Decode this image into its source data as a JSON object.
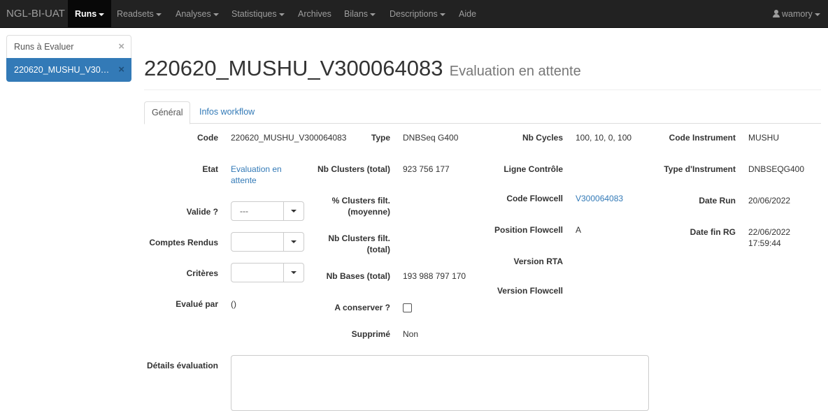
{
  "navbar": {
    "brand": "NGL-BI-UAT",
    "items": [
      {
        "label": "Runs",
        "dropdown": true
      },
      {
        "label": "Readsets",
        "dropdown": true
      },
      {
        "label": "Analyses",
        "dropdown": true
      },
      {
        "label": "Statistiques",
        "dropdown": true
      },
      {
        "label": "Archives",
        "dropdown": false
      },
      {
        "label": "Bilans",
        "dropdown": true
      },
      {
        "label": "Descriptions",
        "dropdown": true
      },
      {
        "label": "Aide",
        "dropdown": false
      }
    ],
    "user": "wamory"
  },
  "sidebar": {
    "items": [
      {
        "label": "Runs à Evaluer",
        "close": "×"
      },
      {
        "label": "220620_MUSHU_V300064083",
        "close": "×"
      }
    ]
  },
  "header": {
    "title": "220620_MUSHU_V300064083",
    "subtitle": "Evaluation en attente"
  },
  "tabs": [
    {
      "label": "Général"
    },
    {
      "label": "Infos workflow"
    }
  ],
  "col1": {
    "code_label": "Code",
    "code_value": "220620_MUSHU_V300064083",
    "etat_label": "Etat",
    "etat_value_line1": "Evaluation en",
    "etat_value_line2": "attente",
    "valide_label": "Valide ?",
    "valide_value": "---",
    "comptes_label": "Comptes Rendus",
    "comptes_value": "",
    "criteres_label": "Critères",
    "criteres_value": "",
    "evalue_label": "Evalué par",
    "evalue_value": "()",
    "details_label": "Détails évaluation"
  },
  "col2": {
    "type_label": "Type",
    "type_value": "DNBSeq G400",
    "nbclusters_label": "Nb Clusters (total)",
    "nbclusters_value": "923 756 177",
    "pctclusters_label_line1": "% Clusters filt.",
    "pctclusters_label_line2": "(moyenne)",
    "nbclustersfilt_label_line1": "Nb Clusters filt.",
    "nbclustersfilt_label_line2": "(total)",
    "nbbases_label": "Nb Bases (total)",
    "nbbases_value": "193 988 797 170",
    "conserver_label": "A conserver ?",
    "supprime_label": "Supprimé",
    "supprime_value": "Non"
  },
  "col3": {
    "nbcycles_label": "Nb Cycles",
    "nbcycles_value": "100, 10, 0, 100",
    "ligne_label": "Ligne Contrôle",
    "flowcell_label": "Code Flowcell",
    "flowcell_value": "V300064083",
    "position_label": "Position Flowcell",
    "position_value": "A",
    "rta_label": "Version RTA",
    "vflowcell_label": "Version Flowcell"
  },
  "col4": {
    "instrument_label": "Code Instrument",
    "instrument_value": "MUSHU",
    "typeinstr_label": "Type d'Instrument",
    "typeinstr_value": "DNBSEQG400",
    "daterun_label": "Date Run",
    "daterun_value": "20/06/2022",
    "datefin_label": "Date fin RG",
    "datefin_value_line1": "22/06/2022",
    "datefin_value_line2": "17:59:44"
  }
}
